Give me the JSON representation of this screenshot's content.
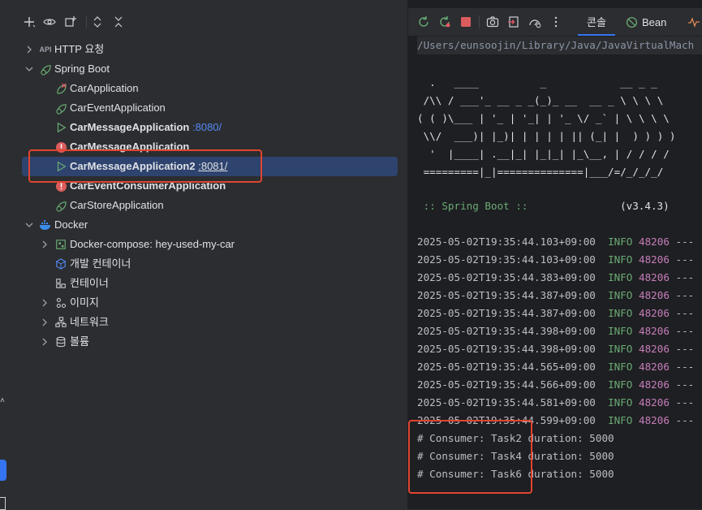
{
  "services": {
    "tree": [
      {
        "label": "HTTP 요청",
        "icon": "api-icon"
      },
      {
        "label": "Spring Boot",
        "icon": "spring-boot-icon"
      },
      {
        "label": "CarApplication",
        "icon": "spring-app-error-icon"
      },
      {
        "label": "CarEventApplication",
        "icon": "spring-app-icon"
      },
      {
        "label": "CarMessageApplication",
        "port": ":8080/",
        "icon": "run-icon"
      },
      {
        "label": "CarMessageApplication",
        "icon": "error-icon"
      },
      {
        "label": "CarMessageApplication2",
        "port": ":8081/",
        "icon": "run-icon"
      },
      {
        "label": "CarEventConsumerApplication",
        "icon": "error-icon"
      },
      {
        "label": "CarStoreApplication",
        "icon": "spring-app-icon"
      },
      {
        "label": "Docker",
        "icon": "docker-icon"
      },
      {
        "label": "Docker-compose: hey-used-my-car",
        "icon": "docker-compose-icon"
      },
      {
        "label": "개발 컨테이너",
        "icon": "dev-container-icon"
      },
      {
        "label": "컨테이너",
        "icon": "containers-icon"
      },
      {
        "label": "이미지",
        "icon": "images-icon"
      },
      {
        "label": "네트워크",
        "icon": "network-icon"
      },
      {
        "label": "볼륨",
        "icon": "volume-icon"
      }
    ]
  },
  "console": {
    "tabs": {
      "console": "콘솔",
      "bean": "Bean"
    },
    "path": "/Users/eunsoojin/Library/Java/JavaVirtualMach",
    "banner": [
      "  .   ____          _            __ _ _",
      " /\\\\ / ___'_ __ _ _(_)_ __  __ _ \\ \\ \\ \\",
      "( ( )\\___ | '_ | '_| | '_ \\/ _` | \\ \\ \\ \\",
      " \\\\/  ___)| |_)| | | | | || (_| |  ) ) ) )",
      "  '  |____| .__|_| |_|_| |_\\__, | / / / /",
      " =========|_|==============|___/=/_/_/_/"
    ],
    "spring_boot_label": " :: Spring Boot :: ",
    "spring_boot_version": "(v3.4.3)",
    "log_lines": [
      {
        "ts": "2025-05-02T19:35:44.103+09:00",
        "level": "INFO",
        "pid": "48206",
        "rest": "---"
      },
      {
        "ts": "2025-05-02T19:35:44.103+09:00",
        "level": "INFO",
        "pid": "48206",
        "rest": "---"
      },
      {
        "ts": "2025-05-02T19:35:44.383+09:00",
        "level": "INFO",
        "pid": "48206",
        "rest": "---"
      },
      {
        "ts": "2025-05-02T19:35:44.387+09:00",
        "level": "INFO",
        "pid": "48206",
        "rest": "---"
      },
      {
        "ts": "2025-05-02T19:35:44.387+09:00",
        "level": "INFO",
        "pid": "48206",
        "rest": "---"
      },
      {
        "ts": "2025-05-02T19:35:44.398+09:00",
        "level": "INFO",
        "pid": "48206",
        "rest": "---"
      },
      {
        "ts": "2025-05-02T19:35:44.398+09:00",
        "level": "INFO",
        "pid": "48206",
        "rest": "---"
      },
      {
        "ts": "2025-05-02T19:35:44.565+09:00",
        "level": "INFO",
        "pid": "48206",
        "rest": "---"
      },
      {
        "ts": "2025-05-02T19:35:44.566+09:00",
        "level": "INFO",
        "pid": "48206",
        "rest": "---"
      },
      {
        "ts": "2025-05-02T19:35:44.581+09:00",
        "level": "INFO",
        "pid": "48206",
        "rest": "---"
      },
      {
        "ts": "2025-05-02T19:35:44.599+09:00",
        "level": "INFO",
        "pid": "48206",
        "rest": "---"
      }
    ],
    "consumer_lines": [
      "# Consumer: Task2 duration: 5000",
      "# Consumer: Task4 duration: 5000",
      "# Consumer: Task6 duration: 5000"
    ]
  },
  "colors": {
    "accent": "#3574f0",
    "highlight_box": "#e0452f",
    "port_link": "#548af7",
    "info": "#6aab73",
    "pid": "#c77dbb"
  }
}
